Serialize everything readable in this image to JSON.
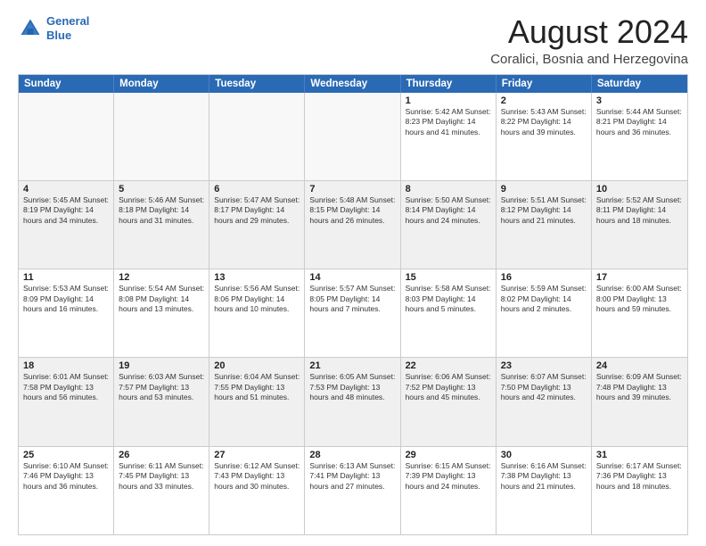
{
  "header": {
    "logo_line1": "General",
    "logo_line2": "Blue",
    "main_title": "August 2024",
    "subtitle": "Coralici, Bosnia and Herzegovina"
  },
  "calendar": {
    "days_of_week": [
      "Sunday",
      "Monday",
      "Tuesday",
      "Wednesday",
      "Thursday",
      "Friday",
      "Saturday"
    ],
    "rows": [
      [
        {
          "day": "",
          "info": "",
          "empty": true
        },
        {
          "day": "",
          "info": "",
          "empty": true
        },
        {
          "day": "",
          "info": "",
          "empty": true
        },
        {
          "day": "",
          "info": "",
          "empty": true
        },
        {
          "day": "1",
          "info": "Sunrise: 5:42 AM\nSunset: 8:23 PM\nDaylight: 14 hours\nand 41 minutes."
        },
        {
          "day": "2",
          "info": "Sunrise: 5:43 AM\nSunset: 8:22 PM\nDaylight: 14 hours\nand 39 minutes."
        },
        {
          "day": "3",
          "info": "Sunrise: 5:44 AM\nSunset: 8:21 PM\nDaylight: 14 hours\nand 36 minutes."
        }
      ],
      [
        {
          "day": "4",
          "info": "Sunrise: 5:45 AM\nSunset: 8:19 PM\nDaylight: 14 hours\nand 34 minutes.",
          "shaded": true
        },
        {
          "day": "5",
          "info": "Sunrise: 5:46 AM\nSunset: 8:18 PM\nDaylight: 14 hours\nand 31 minutes.",
          "shaded": true
        },
        {
          "day": "6",
          "info": "Sunrise: 5:47 AM\nSunset: 8:17 PM\nDaylight: 14 hours\nand 29 minutes.",
          "shaded": true
        },
        {
          "day": "7",
          "info": "Sunrise: 5:48 AM\nSunset: 8:15 PM\nDaylight: 14 hours\nand 26 minutes.",
          "shaded": true
        },
        {
          "day": "8",
          "info": "Sunrise: 5:50 AM\nSunset: 8:14 PM\nDaylight: 14 hours\nand 24 minutes.",
          "shaded": true
        },
        {
          "day": "9",
          "info": "Sunrise: 5:51 AM\nSunset: 8:12 PM\nDaylight: 14 hours\nand 21 minutes.",
          "shaded": true
        },
        {
          "day": "10",
          "info": "Sunrise: 5:52 AM\nSunset: 8:11 PM\nDaylight: 14 hours\nand 18 minutes.",
          "shaded": true
        }
      ],
      [
        {
          "day": "11",
          "info": "Sunrise: 5:53 AM\nSunset: 8:09 PM\nDaylight: 14 hours\nand 16 minutes."
        },
        {
          "day": "12",
          "info": "Sunrise: 5:54 AM\nSunset: 8:08 PM\nDaylight: 14 hours\nand 13 minutes."
        },
        {
          "day": "13",
          "info": "Sunrise: 5:56 AM\nSunset: 8:06 PM\nDaylight: 14 hours\nand 10 minutes."
        },
        {
          "day": "14",
          "info": "Sunrise: 5:57 AM\nSunset: 8:05 PM\nDaylight: 14 hours\nand 7 minutes."
        },
        {
          "day": "15",
          "info": "Sunrise: 5:58 AM\nSunset: 8:03 PM\nDaylight: 14 hours\nand 5 minutes."
        },
        {
          "day": "16",
          "info": "Sunrise: 5:59 AM\nSunset: 8:02 PM\nDaylight: 14 hours\nand 2 minutes."
        },
        {
          "day": "17",
          "info": "Sunrise: 6:00 AM\nSunset: 8:00 PM\nDaylight: 13 hours\nand 59 minutes."
        }
      ],
      [
        {
          "day": "18",
          "info": "Sunrise: 6:01 AM\nSunset: 7:58 PM\nDaylight: 13 hours\nand 56 minutes.",
          "shaded": true
        },
        {
          "day": "19",
          "info": "Sunrise: 6:03 AM\nSunset: 7:57 PM\nDaylight: 13 hours\nand 53 minutes.",
          "shaded": true
        },
        {
          "day": "20",
          "info": "Sunrise: 6:04 AM\nSunset: 7:55 PM\nDaylight: 13 hours\nand 51 minutes.",
          "shaded": true
        },
        {
          "day": "21",
          "info": "Sunrise: 6:05 AM\nSunset: 7:53 PM\nDaylight: 13 hours\nand 48 minutes.",
          "shaded": true
        },
        {
          "day": "22",
          "info": "Sunrise: 6:06 AM\nSunset: 7:52 PM\nDaylight: 13 hours\nand 45 minutes.",
          "shaded": true
        },
        {
          "day": "23",
          "info": "Sunrise: 6:07 AM\nSunset: 7:50 PM\nDaylight: 13 hours\nand 42 minutes.",
          "shaded": true
        },
        {
          "day": "24",
          "info": "Sunrise: 6:09 AM\nSunset: 7:48 PM\nDaylight: 13 hours\nand 39 minutes.",
          "shaded": true
        }
      ],
      [
        {
          "day": "25",
          "info": "Sunrise: 6:10 AM\nSunset: 7:46 PM\nDaylight: 13 hours\nand 36 minutes."
        },
        {
          "day": "26",
          "info": "Sunrise: 6:11 AM\nSunset: 7:45 PM\nDaylight: 13 hours\nand 33 minutes."
        },
        {
          "day": "27",
          "info": "Sunrise: 6:12 AM\nSunset: 7:43 PM\nDaylight: 13 hours\nand 30 minutes."
        },
        {
          "day": "28",
          "info": "Sunrise: 6:13 AM\nSunset: 7:41 PM\nDaylight: 13 hours\nand 27 minutes."
        },
        {
          "day": "29",
          "info": "Sunrise: 6:15 AM\nSunset: 7:39 PM\nDaylight: 13 hours\nand 24 minutes."
        },
        {
          "day": "30",
          "info": "Sunrise: 6:16 AM\nSunset: 7:38 PM\nDaylight: 13 hours\nand 21 minutes."
        },
        {
          "day": "31",
          "info": "Sunrise: 6:17 AM\nSunset: 7:36 PM\nDaylight: 13 hours\nand 18 minutes."
        }
      ]
    ]
  }
}
